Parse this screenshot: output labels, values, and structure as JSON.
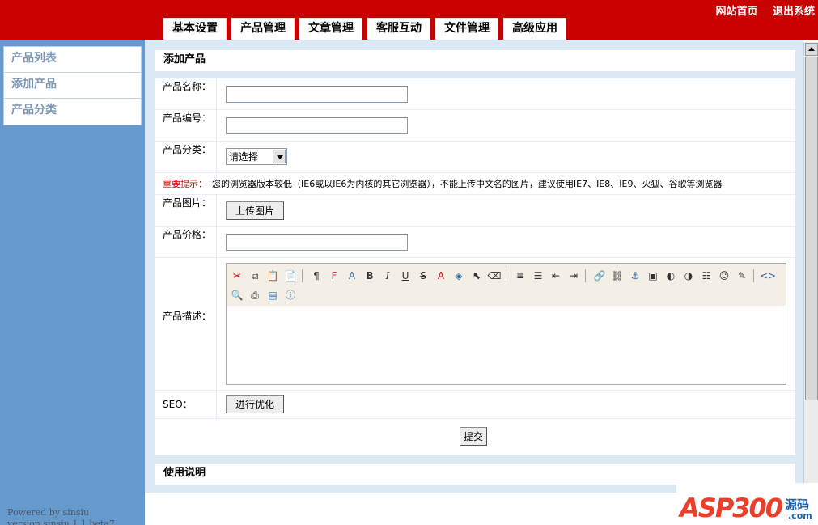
{
  "header": {
    "links": [
      "网站首页",
      "退出系统"
    ],
    "tabs": [
      "基本设置",
      "产品管理",
      "文章管理",
      "客服互动",
      "文件管理",
      "高级应用"
    ]
  },
  "sidebar": {
    "items": [
      "产品列表",
      "添加产品",
      "产品分类"
    ],
    "powered": [
      "Powered by sinsiu",
      "version sinsiu 1.1 beta7"
    ]
  },
  "main": {
    "title": "添加产品",
    "fields": {
      "name_label": "产品名称：",
      "code_label": "产品编号：",
      "category_label": "产品分类：",
      "category_value": "请选择",
      "notice_label": "重要提示：",
      "notice_text": "您的浏览器版本较低（IE6或以IE6为内核的其它浏览器），不能上传中文名的图片，建议使用IE7、IE8、IE9、火狐、谷歌等浏览器",
      "image_label": "产品图片：",
      "upload_button": "上传图片",
      "price_label": "产品价格：",
      "desc_label": "产品描述：",
      "seo_label": "SEO：",
      "seo_button": "进行优化",
      "submit_button": "提交"
    },
    "usage_title": "使用说明"
  },
  "logo": {
    "brand": "ASP300",
    "cn": "源码",
    "domain": ".com"
  }
}
